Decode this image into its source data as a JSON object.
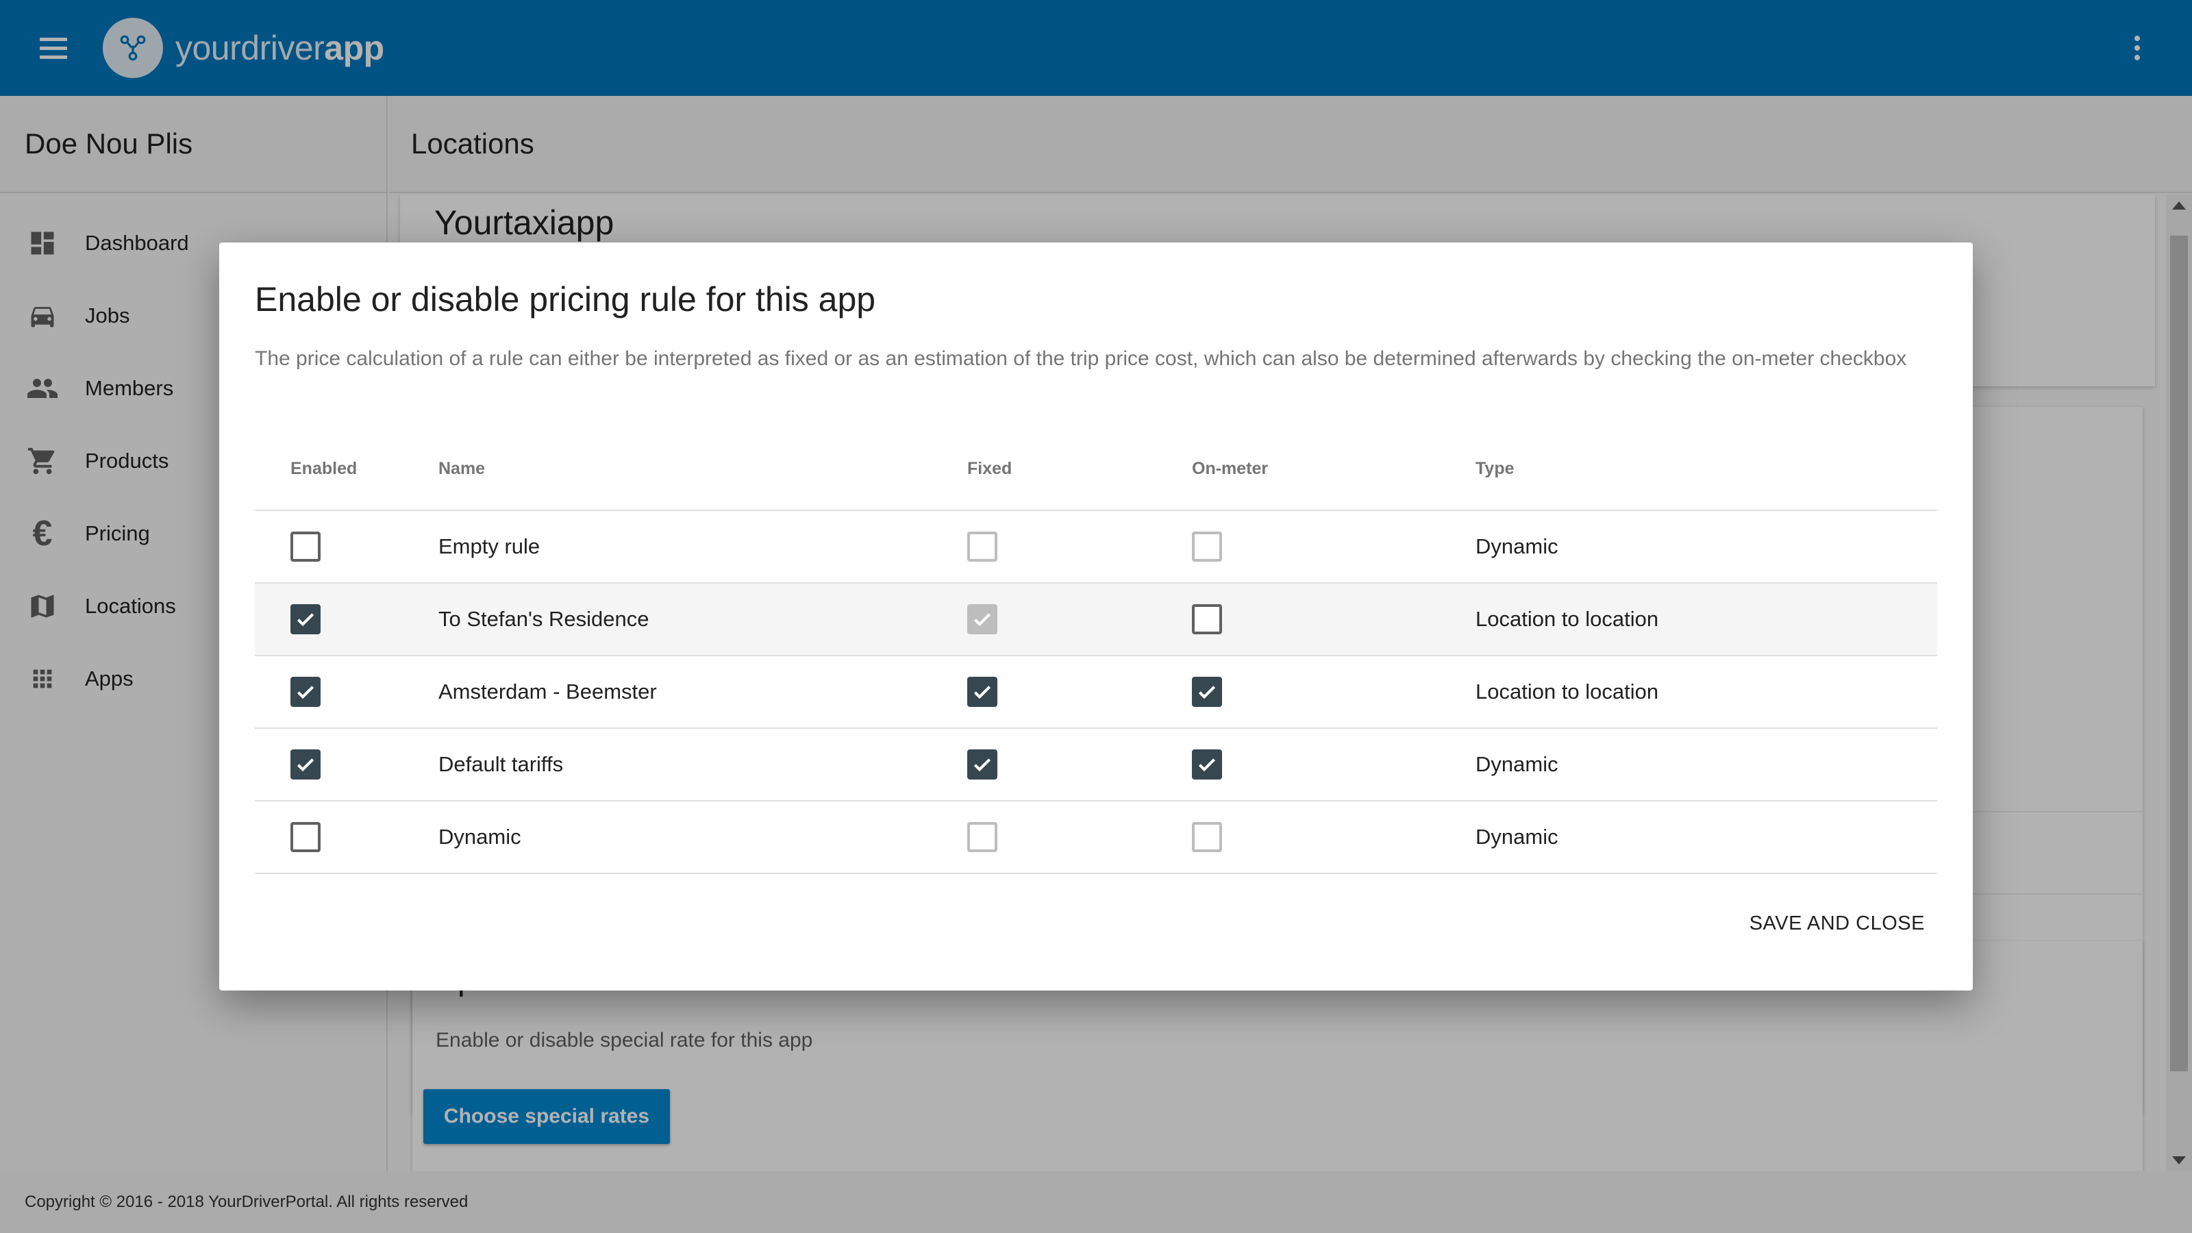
{
  "appbar": {
    "brand_light": "yourdriver",
    "brand_bold": "app"
  },
  "sidebar": {
    "org_name": "Doe Nou Plis",
    "items": [
      {
        "label": "Dashboard",
        "icon": "dashboard-icon"
      },
      {
        "label": "Jobs",
        "icon": "car-icon"
      },
      {
        "label": "Members",
        "icon": "people-icon"
      },
      {
        "label": "Products",
        "icon": "cart-icon"
      },
      {
        "label": "Pricing",
        "icon": "euro-icon"
      },
      {
        "label": "Locations",
        "icon": "map-icon"
      },
      {
        "label": "Apps",
        "icon": "apps-grid-icon"
      }
    ]
  },
  "main": {
    "page_title": "Locations",
    "app_name": "Yourtaxiapp",
    "special_rates": {
      "title": "Special rates",
      "description": "Enable or disable special rate for this app",
      "button_label": "Choose special rates"
    }
  },
  "footer": {
    "copyright": "Copyright © 2016 - 2018 YourDriverPortal. All rights reserved"
  },
  "dialog": {
    "title": "Enable or disable pricing rule for this app",
    "description": "The price calculation of a rule can either be interpreted as fixed or as an estimation of the trip price cost, which can also be determined afterwards by checking the on-meter checkbox",
    "columns": [
      "Enabled",
      "Name",
      "Fixed",
      "On-meter",
      "Type"
    ],
    "rows": [
      {
        "name": "Empty rule",
        "enabled": false,
        "fixed": false,
        "on_meter": false,
        "type": "Dynamic"
      },
      {
        "name": "To Stefan's Residence",
        "enabled": true,
        "fixed": true,
        "fixed_disabled": true,
        "on_meter": false,
        "type": "Location to location"
      },
      {
        "name": "Amsterdam - Beemster",
        "enabled": true,
        "fixed": true,
        "on_meter": true,
        "type": "Location to location"
      },
      {
        "name": "Default tariffs",
        "enabled": true,
        "fixed": true,
        "on_meter": true,
        "type": "Dynamic"
      },
      {
        "name": "Dynamic",
        "enabled": false,
        "fixed": false,
        "on_meter": false,
        "type": "Dynamic"
      }
    ],
    "action_label": "SAVE AND CLOSE"
  },
  "colors": {
    "appbar": "#0277bd",
    "primary_button": "#0288d1",
    "checkbox_checked": "#37474f",
    "overlay": "rgba(0,0,0,0.3)"
  }
}
